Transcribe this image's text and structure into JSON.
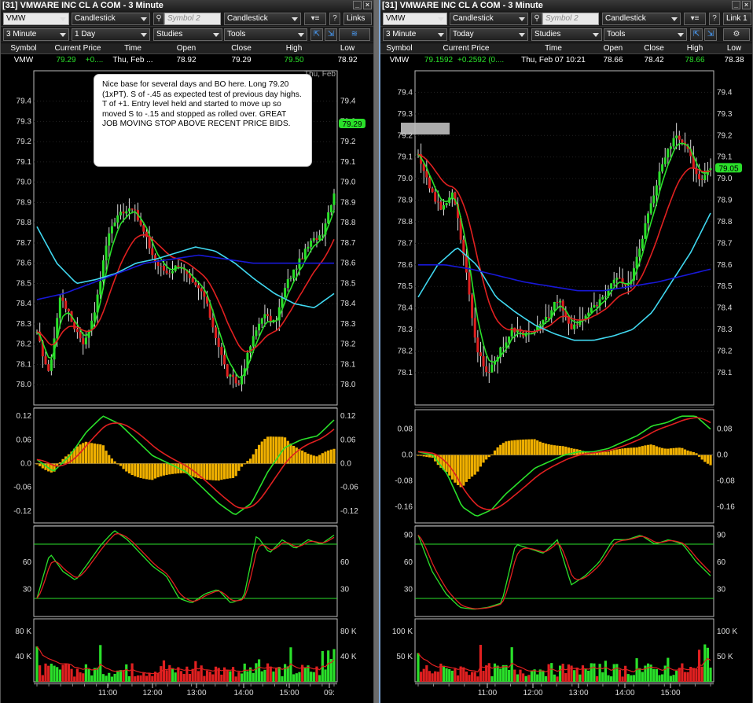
{
  "windows": [
    {
      "id": "L",
      "title": "[31] VMWARE INC CL A COM - 3 Minute",
      "symbol": "VMW",
      "chart_type": "Candlestick",
      "symbol2_placeholder": "Symbol 2",
      "chart_type2": "Candlestick",
      "link_label": "Links",
      "interval": "3 Minute",
      "range": "1 Day",
      "studies_label": "Studies",
      "tools_label": "Tools",
      "quote_headers": [
        "Symbol",
        "Current Price",
        "Time",
        "Open",
        "Close",
        "High",
        "Low"
      ],
      "quote": {
        "symbol": "VMW",
        "price": "79.29",
        "change": "+0....",
        "time": "Thu, Feb ...",
        "open": "78.92",
        "close": "79.29",
        "high": "79.50",
        "low": "78.92"
      },
      "date_label": "Thu, Feb",
      "last_price_tag": "79.29",
      "annotation": "Nice base for several days and BO here.  Long 79.20 (1xPT).  S of -.45 as expected test of previous day highs.  T of +1.  Entry level held and started to move up so moved S to -.15 and stopped as rolled over.  GREAT JOB MOVING STOP ABOVE RECENT PRICE BIDS.",
      "price_ticks": [
        "79.4",
        "79.3",
        "79.2",
        "79.1",
        "79.0",
        "78.9",
        "78.8",
        "78.7",
        "78.6",
        "78.5",
        "78.4",
        "78.3",
        "78.2",
        "78.1",
        "78.0"
      ],
      "macd_ticks": [
        "0.12",
        "0.06",
        "0.0",
        "-0.06",
        "-0.12"
      ],
      "stoch_ticks": [
        "60",
        "30"
      ],
      "stoch_ticks_right": [
        "60",
        "30"
      ],
      "vol_ticks": [
        "80 K",
        "40 K"
      ],
      "time_ticks": [
        "11:00",
        "12:00",
        "13:00",
        "14:00",
        "15:00",
        "09:"
      ],
      "colors": {
        "up": "#2ae02a",
        "down": "#e02020",
        "bars": "#f0b000",
        "ma_fast": "#2ae02a",
        "ma_slow": "#e02020",
        "ma_cyan": "#40d8f0",
        "ma_blue": "#1010d0"
      }
    },
    {
      "id": "R",
      "title": "[31] VMWARE INC CL A COM - 3 Minute",
      "symbol": "VMW",
      "chart_type": "Candlestick",
      "symbol2_placeholder": "Symbol 2",
      "chart_type2": "Candlestick",
      "link_label": "Link 1",
      "interval": "3 Minute",
      "range": "Today",
      "studies_label": "Studies",
      "tools_label": "Tools",
      "quote_headers": [
        "Symbol",
        "Current Price",
        "Time",
        "Open",
        "Close",
        "High",
        "Low"
      ],
      "quote": {
        "symbol": "VMW",
        "price": "79.1592",
        "change": "+0.2592 (0....",
        "time": "Thu, Feb 07  10:21",
        "open": "78.66",
        "close": "78.42",
        "high": "78.66",
        "low": "78.38"
      },
      "last_price_tag": "79.05",
      "price_ticks": [
        "79.4",
        "79.3",
        "79.2",
        "79.1",
        "79.0",
        "78.9",
        "78.8",
        "78.7",
        "78.6",
        "78.5",
        "78.4",
        "78.3",
        "78.2",
        "78.1"
      ],
      "macd_ticks": [
        "0.08",
        "0.0",
        "-0.08",
        "-0.16"
      ],
      "stoch_ticks": [
        "90",
        "60",
        "30"
      ],
      "vol_ticks": [
        "100 K",
        "50 K"
      ],
      "time_ticks": [
        "11:00",
        "12:00",
        "13:00",
        "14:00",
        "15:00"
      ]
    }
  ]
}
